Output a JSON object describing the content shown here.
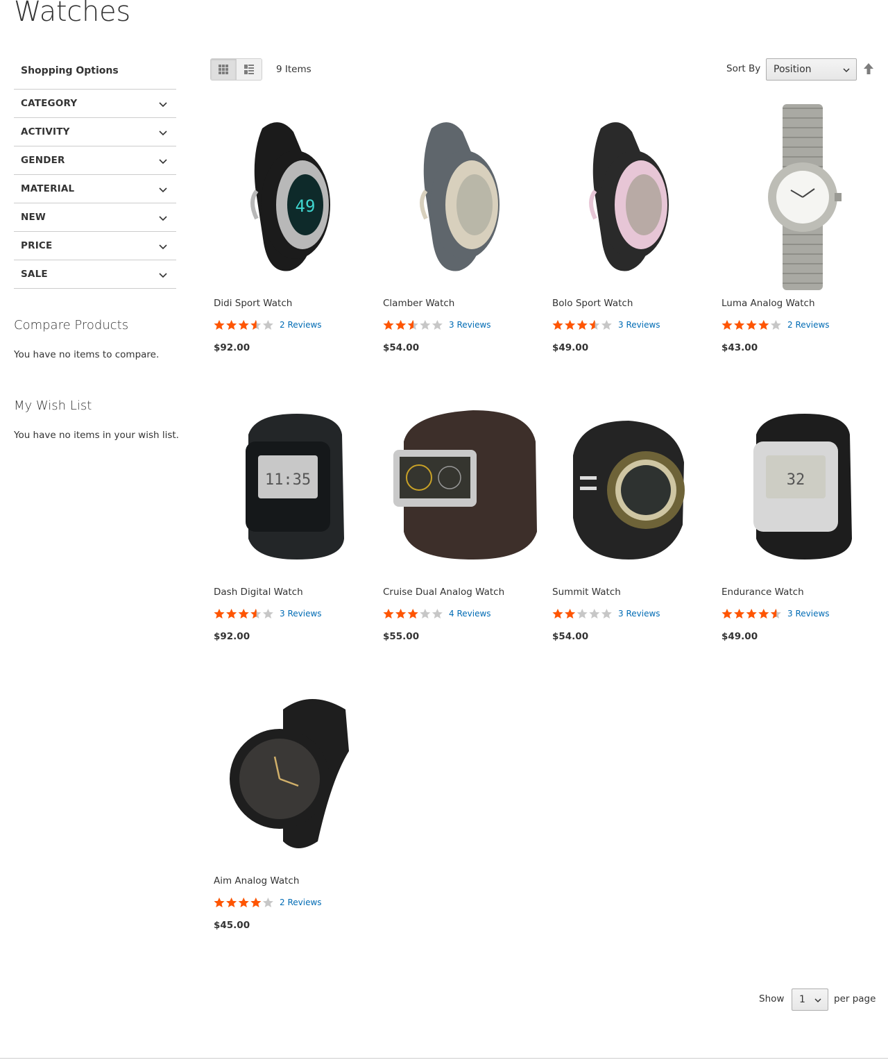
{
  "page_title": "Watches",
  "sidebar": {
    "title": "Shopping Options",
    "filters": [
      "CATEGORY",
      "ACTIVITY",
      "GENDER",
      "MATERIAL",
      "NEW",
      "PRICE",
      "SALE"
    ],
    "compare": {
      "title": "Compare Products",
      "text": "You have no items to compare."
    },
    "wishlist": {
      "title": "My Wish List",
      "text": "You have no items in your wish list."
    }
  },
  "toolbar": {
    "view_modes": [
      "grid",
      "list"
    ],
    "active_mode": "grid",
    "items_count": "9 Items",
    "sort_label": "Sort By",
    "sort_value": "Position",
    "sort_direction_icon": "arrow-up-icon"
  },
  "products": [
    {
      "name": "Didi Sport Watch",
      "rating_pct": 70,
      "reviews": "2 Reviews",
      "price": "$92.00",
      "art": "sport-oval",
      "colors": [
        "#1b1b1b",
        "#b8b8b8",
        "#0e2a2a"
      ],
      "face": "49"
    },
    {
      "name": "Clamber Watch",
      "rating_pct": 50,
      "reviews": "3 Reviews",
      "price": "$54.00",
      "art": "sport-oval",
      "colors": [
        "#5f666c",
        "#d8d0bd",
        "#b9b7a8"
      ],
      "face": ""
    },
    {
      "name": "Bolo Sport Watch",
      "rating_pct": 70,
      "reviews": "3 Reviews",
      "price": "$49.00",
      "art": "sport-oval",
      "colors": [
        "#2a2a2a",
        "#e7c6d6",
        "#b8aaa5"
      ],
      "face": ""
    },
    {
      "name": "Luma Analog Watch",
      "rating_pct": 80,
      "reviews": "2 Reviews",
      "price": "$43.00",
      "art": "metal-analog",
      "colors": [
        "#a9a9a3",
        "#f5f5f2",
        "#444444"
      ],
      "face": ""
    },
    {
      "name": "Dash Digital Watch",
      "rating_pct": 70,
      "reviews": "3 Reviews",
      "price": "$92.00",
      "art": "digital-rect",
      "colors": [
        "#232628",
        "#15181a",
        "#c8c8c8"
      ],
      "face": "11:35"
    },
    {
      "name": "Cruise Dual Analog Watch",
      "rating_pct": 60,
      "reviews": "4 Reviews",
      "price": "$55.00",
      "art": "dual-analog",
      "colors": [
        "#3d2f2a",
        "#c9c9c9",
        "#35352f"
      ],
      "face": ""
    },
    {
      "name": "Summit Watch",
      "rating_pct": 40,
      "reviews": "3 Reviews",
      "price": "$54.00",
      "art": "summit-round",
      "colors": [
        "#242424",
        "#6e6338",
        "#2e3230"
      ],
      "face": ""
    },
    {
      "name": "Endurance Watch",
      "rating_pct": 90,
      "reviews": "3 Reviews",
      "price": "$49.00",
      "art": "digital-rect",
      "colors": [
        "#1d1d1d",
        "#d7d7d7",
        "#cdcdc4"
      ],
      "face": "32"
    },
    {
      "name": "Aim Analog Watch",
      "rating_pct": 80,
      "reviews": "2 Reviews",
      "price": "$45.00",
      "art": "black-analog",
      "colors": [
        "#1e1e1e",
        "#3a3836",
        "#d1b06a"
      ],
      "face": ""
    }
  ],
  "limiter": {
    "show_label": "Show",
    "value": "1",
    "per_page_label": "per page"
  },
  "colors": {
    "star_fill": "#ff5501",
    "star_empty": "#c7c7c7",
    "link": "#006bb4",
    "text": "#333333",
    "border": "#cccccc"
  }
}
